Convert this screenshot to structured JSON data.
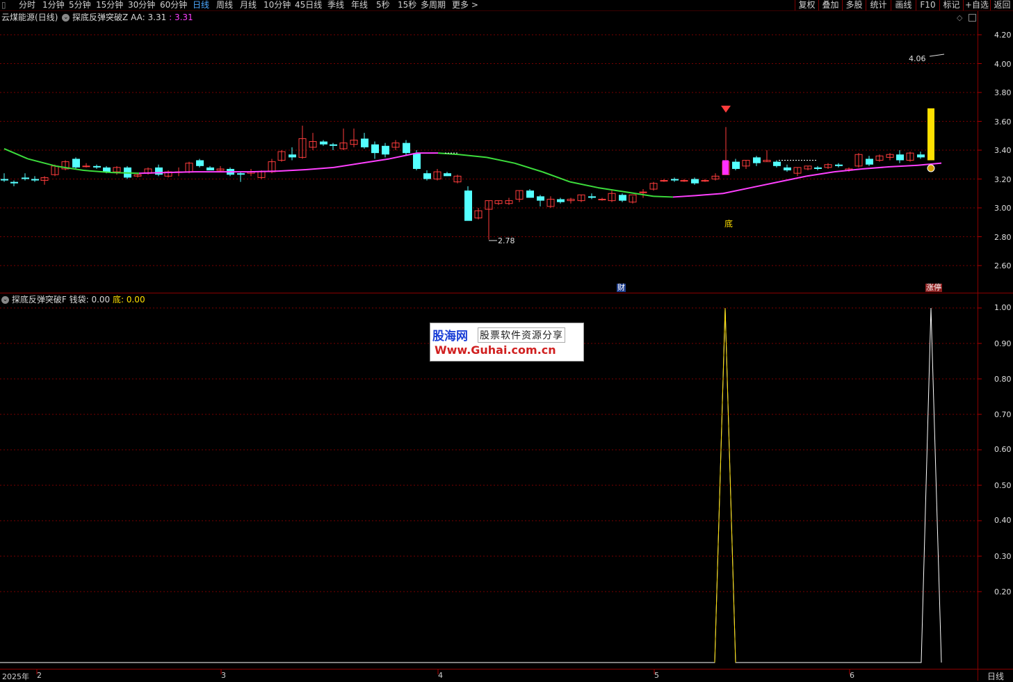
{
  "toolbar": {
    "tabs": [
      "分时",
      "1分钟",
      "5分钟",
      "15分钟",
      "30分钟",
      "60分钟",
      "日线",
      "周线",
      "月线",
      "10分钟",
      "45日线",
      "季线",
      "年线",
      "5秒",
      "15秒",
      "多周期",
      "更多 >"
    ],
    "active_tab": "日线",
    "right_buttons": [
      "复权",
      "叠加",
      "多股",
      "统计",
      "画线",
      "F10",
      "标记",
      "+自选",
      "返回"
    ]
  },
  "main_chart": {
    "stock_name": "云煤能源",
    "period": "(日线)",
    "indicator_name": "探底反弹突破Z",
    "aa_label": "AA:",
    "aa_value": "3.31",
    "aa_value2": "3.31",
    "high_marker": "4.06",
    "low_marker": "2.78",
    "bottom_label": "底",
    "cai_label": "财",
    "zhangting_label": "涨停",
    "y_ticks": [
      "4.20",
      "4.00",
      "3.80",
      "3.60",
      "3.40",
      "3.20",
      "3.00",
      "2.80",
      "2.60"
    ]
  },
  "indicator_chart": {
    "name": "探底反弹突破F",
    "qiandai_label": "钱袋:",
    "qiandai_value": "0.00",
    "di_label": "底:",
    "di_value": "0.00",
    "y_ticks": [
      "1.00",
      "0.90",
      "0.80",
      "0.70",
      "0.60",
      "0.50",
      "0.40",
      "0.30",
      "0.20"
    ]
  },
  "x_axis": {
    "labels": [
      "2025年",
      "2",
      "3",
      "4",
      "5",
      "6"
    ],
    "period_label": "日线"
  },
  "watermark": {
    "brand": "股海网",
    "slogan": "股票软件资源分享",
    "url": "Www.Guhai.com.cn"
  },
  "colors": {
    "up": "#ff3c3c",
    "down": "#54ffff",
    "ma_up": "#ff40ff",
    "ma_down": "#3cdc3c",
    "grid": "#7a0000",
    "signal_bar": "#ffe000"
  },
  "chart_data": {
    "type": "candlestick",
    "series": [
      {
        "name": "AA",
        "values": [
          3.31
        ]
      }
    ],
    "ylim": [
      2.5,
      4.3
    ],
    "indicator_ylim": [
      0.1,
      1.05
    ]
  }
}
